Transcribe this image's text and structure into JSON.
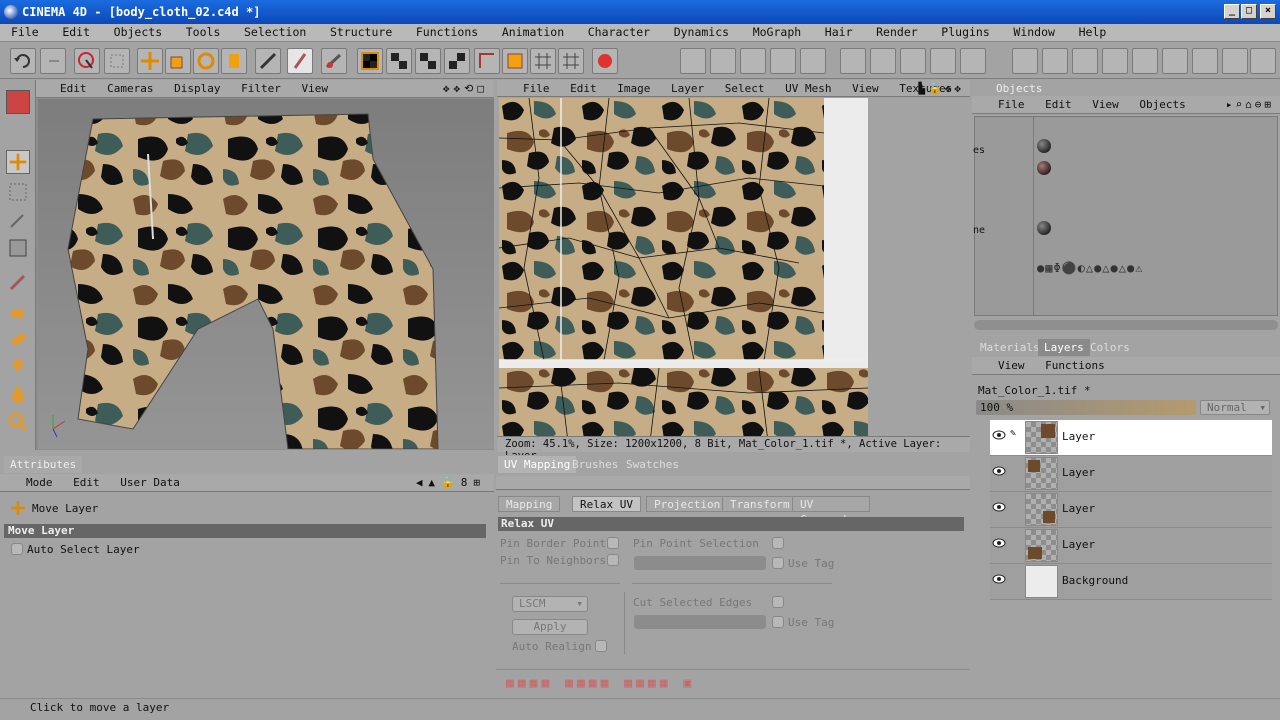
{
  "window": {
    "title": "CINEMA 4D - [body_cloth_02.c4d *]",
    "min": "_",
    "max": "□",
    "close": "×"
  },
  "menubar": [
    "File",
    "Edit",
    "Objects",
    "Tools",
    "Selection",
    "Structure",
    "Functions",
    "Animation",
    "Character",
    "Dynamics",
    "MoGraph",
    "Hair",
    "Render",
    "Plugins",
    "Window",
    "Help"
  ],
  "viewport": {
    "menu": [
      "Edit",
      "Cameras",
      "Display",
      "Filter",
      "View"
    ]
  },
  "texture_view": {
    "menu": [
      "File",
      "Edit",
      "Image",
      "Layer",
      "Select",
      "UV Mesh",
      "View",
      "Textures"
    ],
    "status": "Zoom: 45.1%, Size: 1200x1200, 8 Bit, Mat_Color_1.tif *, Active Layer: Layer"
  },
  "objects": {
    "title": "Objects",
    "menu": [
      "File",
      "Edit",
      "View",
      "Objects"
    ],
    "row_labels": [
      "es",
      "ne"
    ]
  },
  "attributes": {
    "tab": "Attributes",
    "menu": [
      "Mode",
      "Edit",
      "User Data"
    ],
    "tool_name": "Move Layer",
    "section": "Move Layer",
    "option": "Auto Select Layer"
  },
  "uv": {
    "tabs": [
      "UV Mapping",
      "Brushes",
      "Swatches"
    ],
    "subtabs": [
      "Mapping",
      "Relax UV",
      "Projection",
      "Transform",
      "UV Commands"
    ],
    "section": "Relax UV",
    "pin_border": "Pin Border Points",
    "pin_neighbors": "Pin To Neighbors",
    "pin_point": "Pin Point Selection",
    "use_tag_1": "Use Tag",
    "cut_edges": "Cut Selected Edges",
    "use_tag_2": "Use Tag",
    "method": "LSCM",
    "apply": "Apply",
    "auto_realign": "Auto Realign"
  },
  "layers_panel": {
    "tabs": [
      "Materials",
      "Layers",
      "Colors"
    ],
    "menu": [
      "View",
      "Functions"
    ],
    "file": "Mat_Color_1.tif *",
    "opacity": "100 %",
    "blend": "Normal",
    "layers": [
      {
        "name": "Layer",
        "selected": true
      },
      {
        "name": "Layer",
        "selected": false
      },
      {
        "name": "Layer",
        "selected": false
      },
      {
        "name": "Layer",
        "selected": false
      },
      {
        "name": "Background",
        "selected": false
      }
    ]
  },
  "statusbar": "Click to move a layer",
  "colors": {
    "titlebar": "#0c48b8",
    "panel": "#a3a3a3",
    "camo_tan": "#c7ad86",
    "camo_brown": "#6e4a2d",
    "camo_green": "#3e5c58",
    "camo_black": "#111111"
  }
}
